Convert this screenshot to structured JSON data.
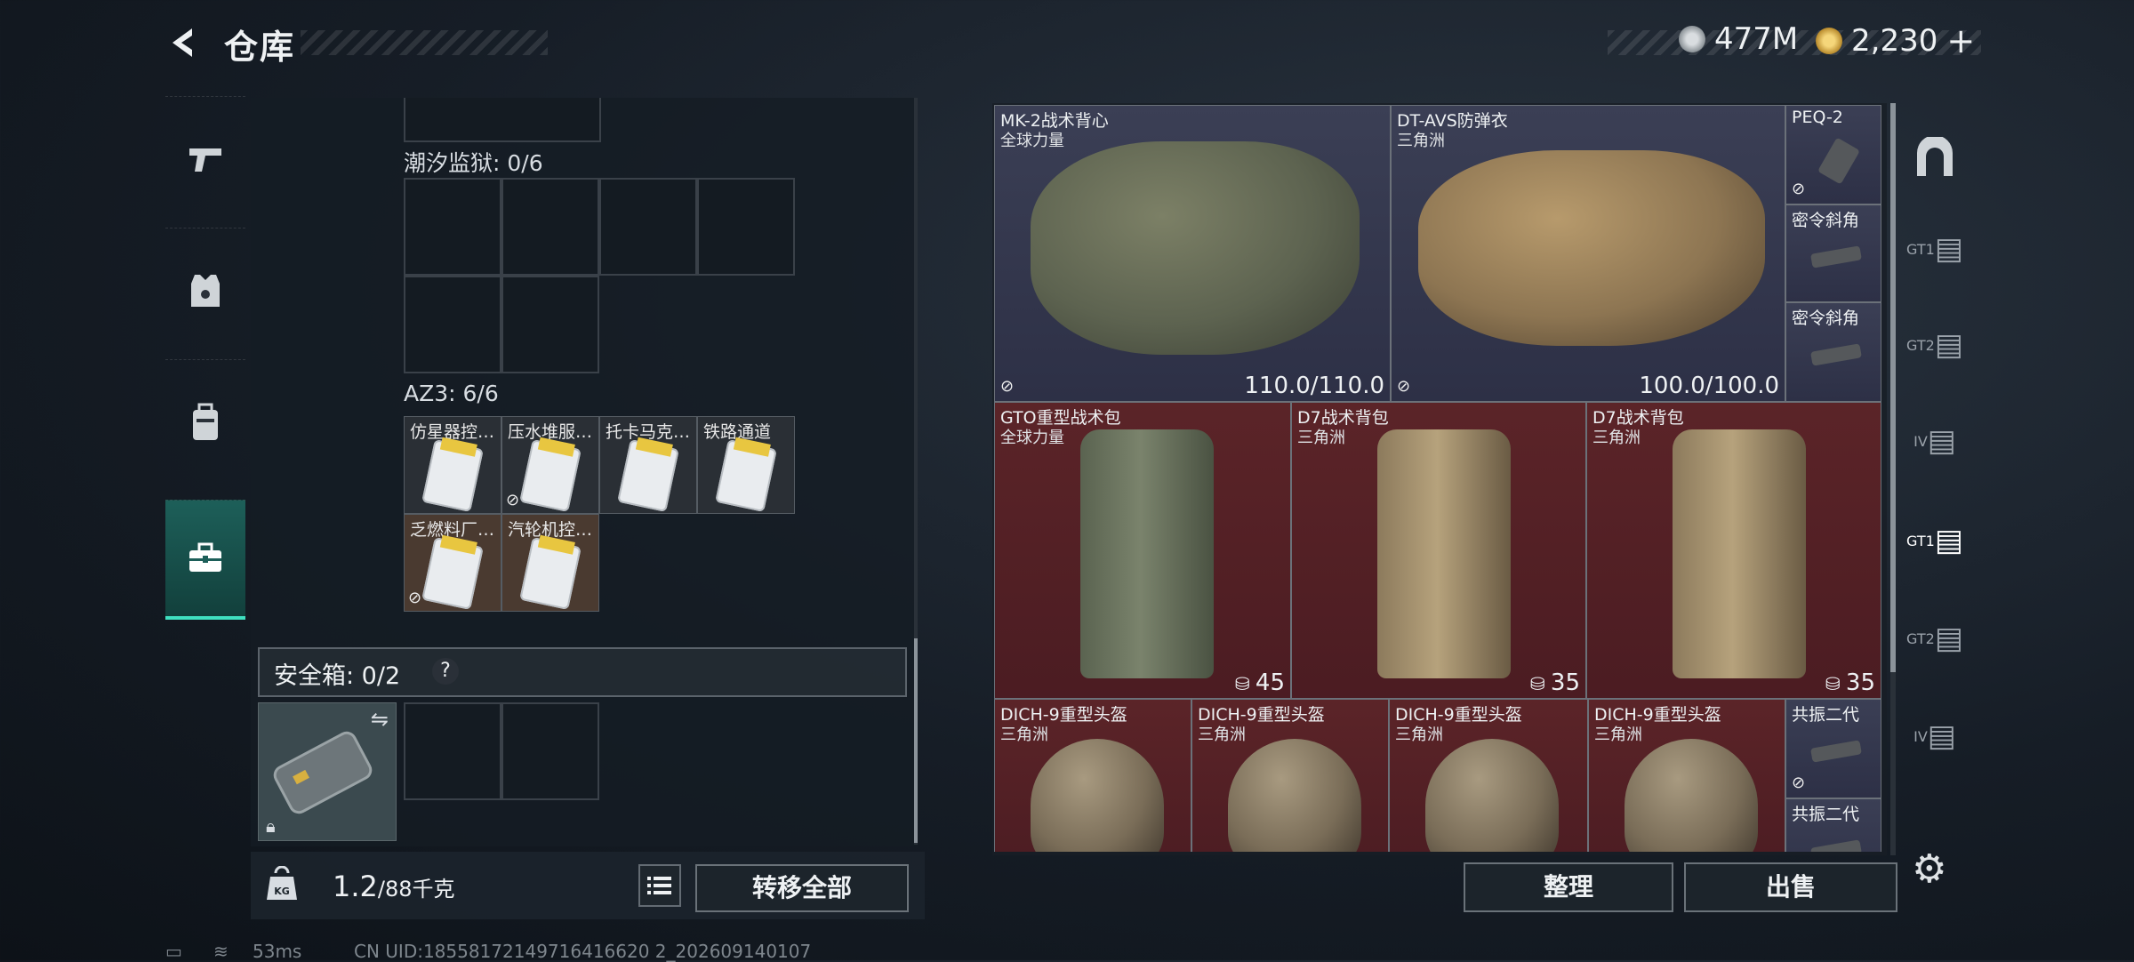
{
  "header": {
    "title": "仓库",
    "currency_silver": "477M",
    "currency_gold": "2,230",
    "gold_plus": "+"
  },
  "nav": {
    "items": [
      "weapon-icon",
      "armor-icon",
      "backpack-icon",
      "toolbox-icon"
    ],
    "active": 3
  },
  "stash": {
    "container1_label": "潮汐监狱: 0/6",
    "container2_label": "AZ3: 6/6",
    "container2_items": [
      {
        "name": "仿星器控…",
        "brown": false,
        "no_transfer": false
      },
      {
        "name": "压水堆服…",
        "brown": false,
        "no_transfer": true
      },
      {
        "name": "托卡马克…",
        "brown": false,
        "no_transfer": false
      },
      {
        "name": "铁路通道",
        "brown": false,
        "no_transfer": false
      },
      {
        "name": "乏燃料厂…",
        "brown": true,
        "no_transfer": true
      },
      {
        "name": "汽轮机控…",
        "brown": true,
        "no_transfer": false
      }
    ],
    "safe_label": "安全箱: 0/2",
    "help": "?"
  },
  "bottom_left": {
    "weight_value": "1.2",
    "weight_max": "/88千克",
    "transfer_all": "转移全部",
    "weight_icon_text": "KG"
  },
  "right": {
    "row1": [
      {
        "name": "MK-2战术背心",
        "sub": "全球力量",
        "value": "110.0/110.0"
      },
      {
        "name": "DT-AVS防弹衣",
        "sub": "三角洲",
        "value": "100.0/100.0"
      }
    ],
    "row1_small": [
      {
        "name": "PEQ-2"
      },
      {
        "name": "密令斜角"
      },
      {
        "name": "密令斜角"
      }
    ],
    "row2": [
      {
        "name": "GTO重型战术包",
        "sub": "全球力量",
        "value": "45"
      },
      {
        "name": "D7战术背包",
        "sub": "三角洲",
        "value": "35"
      },
      {
        "name": "D7战术背包",
        "sub": "三角洲",
        "value": "35"
      }
    ],
    "row3": [
      {
        "name": "DICH-9重型头盔",
        "sub": "三角洲"
      },
      {
        "name": "DICH-9重型头盔",
        "sub": "三角洲"
      },
      {
        "name": "DICH-9重型头盔",
        "sub": "三角洲"
      },
      {
        "name": "DICH-9重型头盔",
        "sub": "三角洲"
      }
    ],
    "row3_small": [
      {
        "name": "共振二代"
      },
      {
        "name": "共振二代"
      }
    ],
    "organize": "整理",
    "sell": "出售"
  },
  "right_nav": {
    "labels": [
      "GT1",
      "GT2",
      "IV",
      "GT1",
      "GT2",
      "IV"
    ]
  },
  "footer": {
    "ping": "53ms",
    "uid": "CN UID:18558172149716416620 2_202609140107"
  }
}
